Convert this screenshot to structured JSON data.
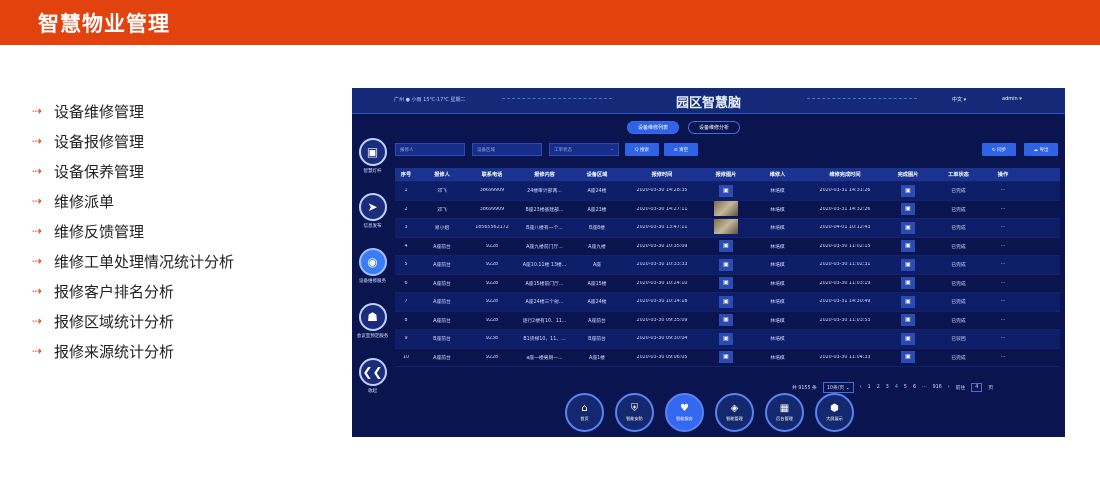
{
  "page": {
    "title": "智慧物业管理"
  },
  "features": [
    "设备维修管理",
    "设备报修管理",
    "设备保养管理",
    "维修派单",
    "维修反馈管理",
    "维修工单处理情况统计分析",
    "报修客户排名分析",
    "报修区域统计分析",
    "报修来源统计分析"
  ],
  "app": {
    "title": "园区智慧脑",
    "weather": "广州 ● 小雨 15℃-17℃ 星期二",
    "lang": "中文 ▾",
    "user": "admin ▾",
    "tabs": [
      "设备维修列表",
      "设备维修分析"
    ],
    "side_nav": [
      {
        "icon": "▣",
        "label": "智慧灯杆"
      },
      {
        "icon": "➤",
        "label": "信息发布"
      },
      {
        "icon": "◉",
        "label": "设备维修服务"
      },
      {
        "icon": "☗",
        "label": "会议室预定服务"
      },
      {
        "icon": "❮❮",
        "label": "收起"
      }
    ],
    "filters": {
      "reporter_placeholder": "报修人",
      "area_placeholder": "设备区域",
      "status_placeholder": "工单状态",
      "search": "Q 搜索",
      "clear": "⊘ 清空",
      "sync": "↻ 同步",
      "export": "☁ 导出"
    },
    "table": {
      "headers": [
        "序号",
        "报修人",
        "联系电话",
        "报修内容",
        "设备区域",
        "报修时间",
        "报修图片",
        "维修人",
        "维修完成时间",
        "完成图片",
        "工单状态",
        "操作"
      ],
      "rows": [
        [
          "1",
          "邓飞",
          "38699909",
          "24楼审计部两...",
          "A座24楼",
          "2020-03-30 14:28:35",
          "icon",
          "林培棋",
          "2020-03-31 14:31:26",
          "icon",
          "已完成",
          "···"
        ],
        [
          "2",
          "邓飞",
          "38699909",
          "B座23楼基建部...",
          "A座23楼",
          "2020-03-30 14:27:11",
          "photo",
          "林培棋",
          "2020-03-31 14:32:26",
          "icon",
          "已完成",
          "···"
        ],
        [
          "3",
          "易小姐",
          "18565562172",
          "B座八楼有一个...",
          "B座8楼",
          "2020-03-30 13:47:11",
          "photo",
          "林培棋",
          "2020-04-01 10:12:43",
          "icon",
          "已完成",
          "···"
        ],
        [
          "4",
          "A座前台",
          "9228",
          "A座九楼前门厅...",
          "A座九楼",
          "2020-03-30 10:35:09",
          "icon",
          "林培棋",
          "2020-03-30 11:02:15",
          "icon",
          "已完成",
          "···"
        ],
        [
          "5",
          "A座前台",
          "9228",
          "A座10.11楼 13楼...",
          "A座",
          "2020-03-30 10:33:33",
          "icon",
          "林培棋",
          "2020-03-30 11:02:31",
          "icon",
          "已完成",
          "···"
        ],
        [
          "6",
          "A座前台",
          "9228",
          "A座15楼前门厅...",
          "A座15楼",
          "2020-03-30 10:24:10",
          "icon",
          "林培棋",
          "2020-03-30 11:03:19",
          "icon",
          "已完成",
          "···"
        ],
        [
          "7",
          "A座前台",
          "9228",
          "A座24楼三个射...",
          "A座24楼",
          "2020-03-30 10:14:18",
          "icon",
          "林培棋",
          "2020-03-31 14:30:49",
          "icon",
          "已完成",
          "···"
        ],
        [
          "8",
          "A座前台",
          "9228",
          "逐行2楼有10、11...",
          "A座前台",
          "2020-03-30 09:35:09",
          "icon",
          "林培棋",
          "2020-03-30 11:03:53",
          "icon",
          "已完成",
          "···"
        ],
        [
          "9",
          "B座前台",
          "9238",
          "B1货梯10、11、...",
          "B座前台",
          "2020-03-30 09:30:04",
          "icon",
          "林培棋",
          "",
          "icon",
          "已驳回",
          "···"
        ],
        [
          "10",
          "A座前台",
          "9228",
          "a座一楼男厕一...",
          "A座1楼",
          "2020-03-30 09:06:05",
          "icon",
          "林培棋",
          "2020-03-30 11:04:33",
          "icon",
          "已完成",
          "···"
        ]
      ]
    },
    "pager": {
      "total": "共 9155 条",
      "size": "10条/页 ⌄",
      "prev": "‹",
      "pages": [
        "1",
        "2",
        "3",
        "4",
        "5",
        "6",
        "···",
        "916"
      ],
      "next": "›",
      "goto": "前往",
      "goto_val": "4",
      "page_unit": "页"
    },
    "bottom_nav": [
      {
        "icon": "⌂",
        "label": "首页"
      },
      {
        "icon": "⛨",
        "label": "智能安防"
      },
      {
        "icon": "♥",
        "label": "智能服务"
      },
      {
        "icon": "◈",
        "label": "智能管理"
      },
      {
        "icon": "▦",
        "label": "后台管理"
      },
      {
        "icon": "⬢",
        "label": "大屏展示"
      }
    ]
  }
}
